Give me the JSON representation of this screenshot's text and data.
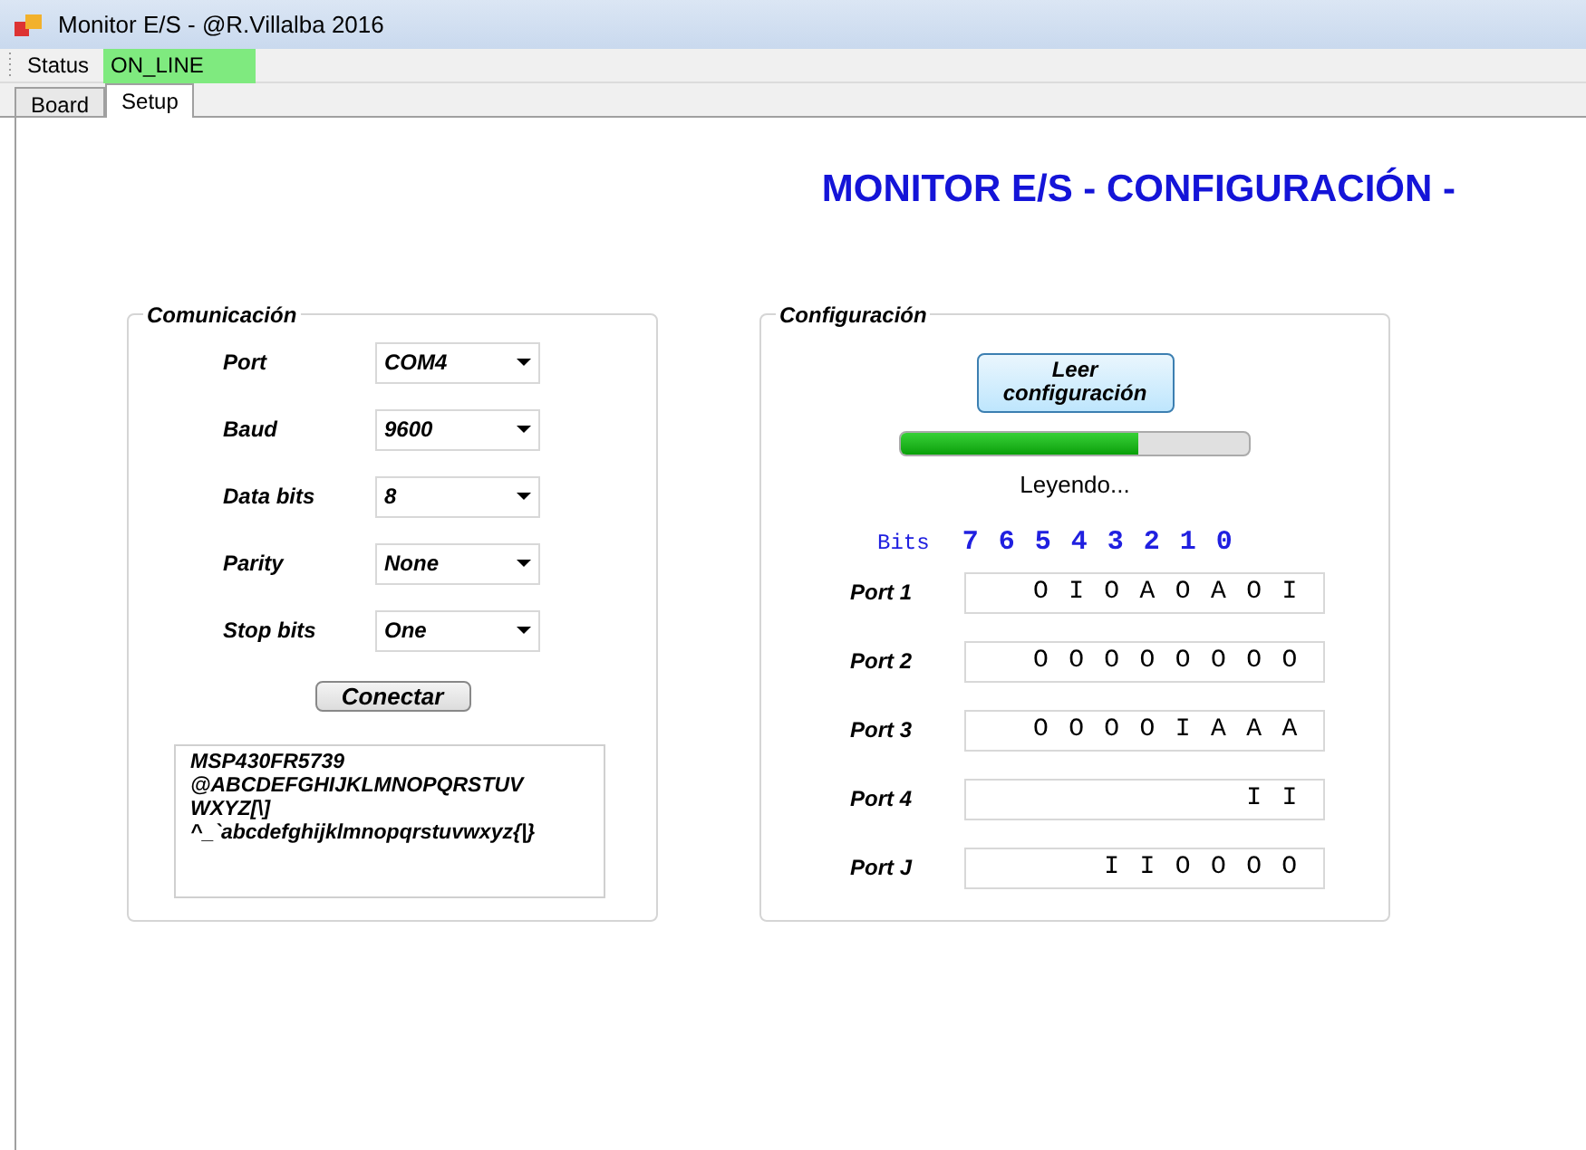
{
  "window": {
    "title": "Monitor E/S  -  @R.Villalba 2016"
  },
  "status_strip": {
    "label": "Status",
    "value": "ON_LINE"
  },
  "tabs": [
    {
      "label": "Board",
      "selected": false
    },
    {
      "label": "Setup",
      "selected": true
    }
  ],
  "heading": "MONITOR E/S  - CONFIGURACIÓN -",
  "comunicacion": {
    "title": "Comunicación",
    "fields": [
      {
        "label": "Port",
        "value": "COM4"
      },
      {
        "label": "Baud",
        "value": "9600"
      },
      {
        "label": "Data bits",
        "value": "8"
      },
      {
        "label": "Parity",
        "value": "None"
      },
      {
        "label": "Stop bits",
        "value": "One"
      }
    ],
    "button": "Conectar",
    "log": [
      "MSP430FR5739",
      "@ABCDEFGHIJKLMNOPQRSTUV",
      "WXYZ[\\]",
      "^_`abcdefghijklmnopqrstuvwxyz{|}"
    ]
  },
  "configuracion": {
    "title": "Configuración",
    "button": "Leer configuración",
    "progress": {
      "level": 0.68
    },
    "status": "Leyendo...",
    "bits_label": "Bits",
    "bits": "7 6 5 4 3 2 1 0",
    "ports": [
      {
        "label": "Port 1",
        "value": "O I O A O A O I"
      },
      {
        "label": "Port 2",
        "value": "O O O O O O O O"
      },
      {
        "label": "Port 3",
        "value": "O O O O I A A A"
      },
      {
        "label": "Port 4",
        "value": "I I"
      },
      {
        "label": "Port J",
        "value": "I I O O O O"
      }
    ]
  }
}
